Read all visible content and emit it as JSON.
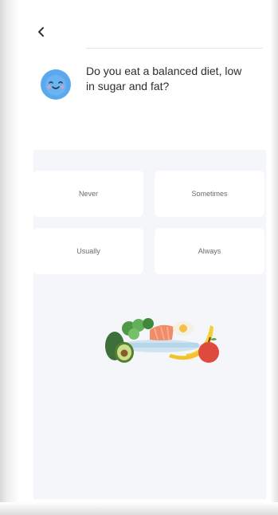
{
  "question": {
    "line1": "Do you eat a balanced diet, low",
    "line2": "in sugar and fat?"
  },
  "options": [
    {
      "label": "Never"
    },
    {
      "label": "Sometimes"
    },
    {
      "label": "Usually"
    },
    {
      "label": "Always"
    }
  ],
  "icons": {
    "back": "chevron-left-icon",
    "avatar": "smiley-face-icon",
    "illustration": "healthy-food-illustration"
  },
  "colors": {
    "avatar": "#5aa9ee",
    "panel": "#f4f6fa",
    "text": "#2d2d2d",
    "option_text": "#6a6a6a"
  }
}
